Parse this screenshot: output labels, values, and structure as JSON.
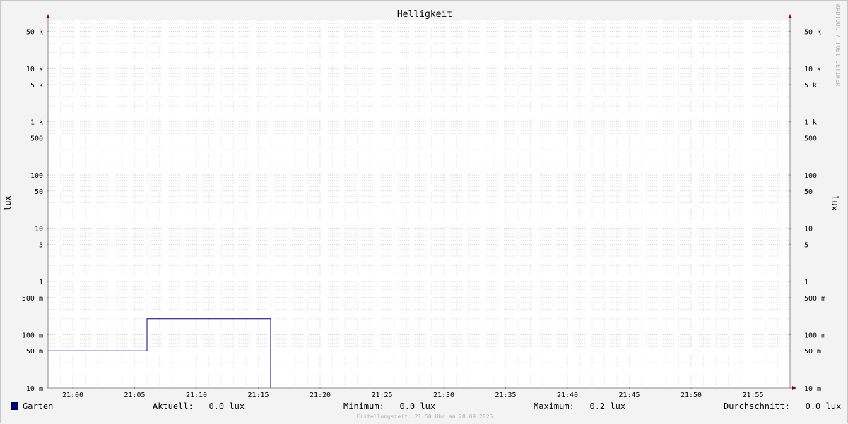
{
  "chart_data": {
    "type": "line",
    "title": "Helligkeit",
    "ylabel": "lux",
    "y_scale": "log",
    "ylim": [
      0.01,
      80000
    ],
    "xlim": [
      "20:58",
      "21:58"
    ],
    "x_ticks": [
      "21:00",
      "21:05",
      "21:10",
      "21:15",
      "21:20",
      "21:25",
      "21:30",
      "21:35",
      "21:40",
      "21:45",
      "21:50",
      "21:55"
    ],
    "y_tick_labels": [
      {
        "value": 50000,
        "label": "50 k"
      },
      {
        "value": 10000,
        "label": "10 k"
      },
      {
        "value": 5000,
        "label": "5 k"
      },
      {
        "value": 1000,
        "label": "1 k"
      },
      {
        "value": 500,
        "label": "500"
      },
      {
        "value": 100,
        "label": "100"
      },
      {
        "value": 50,
        "label": "50"
      },
      {
        "value": 10,
        "label": "10"
      },
      {
        "value": 5,
        "label": "5"
      },
      {
        "value": 1,
        "label": "1"
      },
      {
        "value": 0.5,
        "label": "500 m"
      },
      {
        "value": 0.1,
        "label": "100 m"
      },
      {
        "value": 0.05,
        "label": "50 m"
      },
      {
        "value": 0.01,
        "label": "10 m"
      }
    ],
    "series": [
      {
        "name": "Garten",
        "color": "#00008b",
        "points": [
          {
            "x": "20:58",
            "y": 0.05
          },
          {
            "x": "21:06",
            "y": 0.05
          },
          {
            "x": "21:06",
            "y": 0.2
          },
          {
            "x": "21:16",
            "y": 0.2
          },
          {
            "x": "21:16",
            "y": 0.01
          },
          {
            "x": "21:58",
            "y": 0.01
          }
        ]
      }
    ],
    "grid": true,
    "legend_position": "bottom"
  },
  "legend": {
    "series_name": "Garten",
    "aktuell_label": "Aktuell:",
    "aktuell_value": "0.0 lux",
    "minimum_label": "Minimum:",
    "minimum_value": "0.0 lux",
    "maximum_label": "Maximum:",
    "maximum_value": "0.2 lux",
    "durchschnitt_label": "Durchschnitt:",
    "durchschnitt_value": "0.0 lux"
  },
  "footer": "Erstellungszeit: 21:58 Uhr am 28.09.2025",
  "watermark": "RRDTOOL / TOBI OETIKER"
}
